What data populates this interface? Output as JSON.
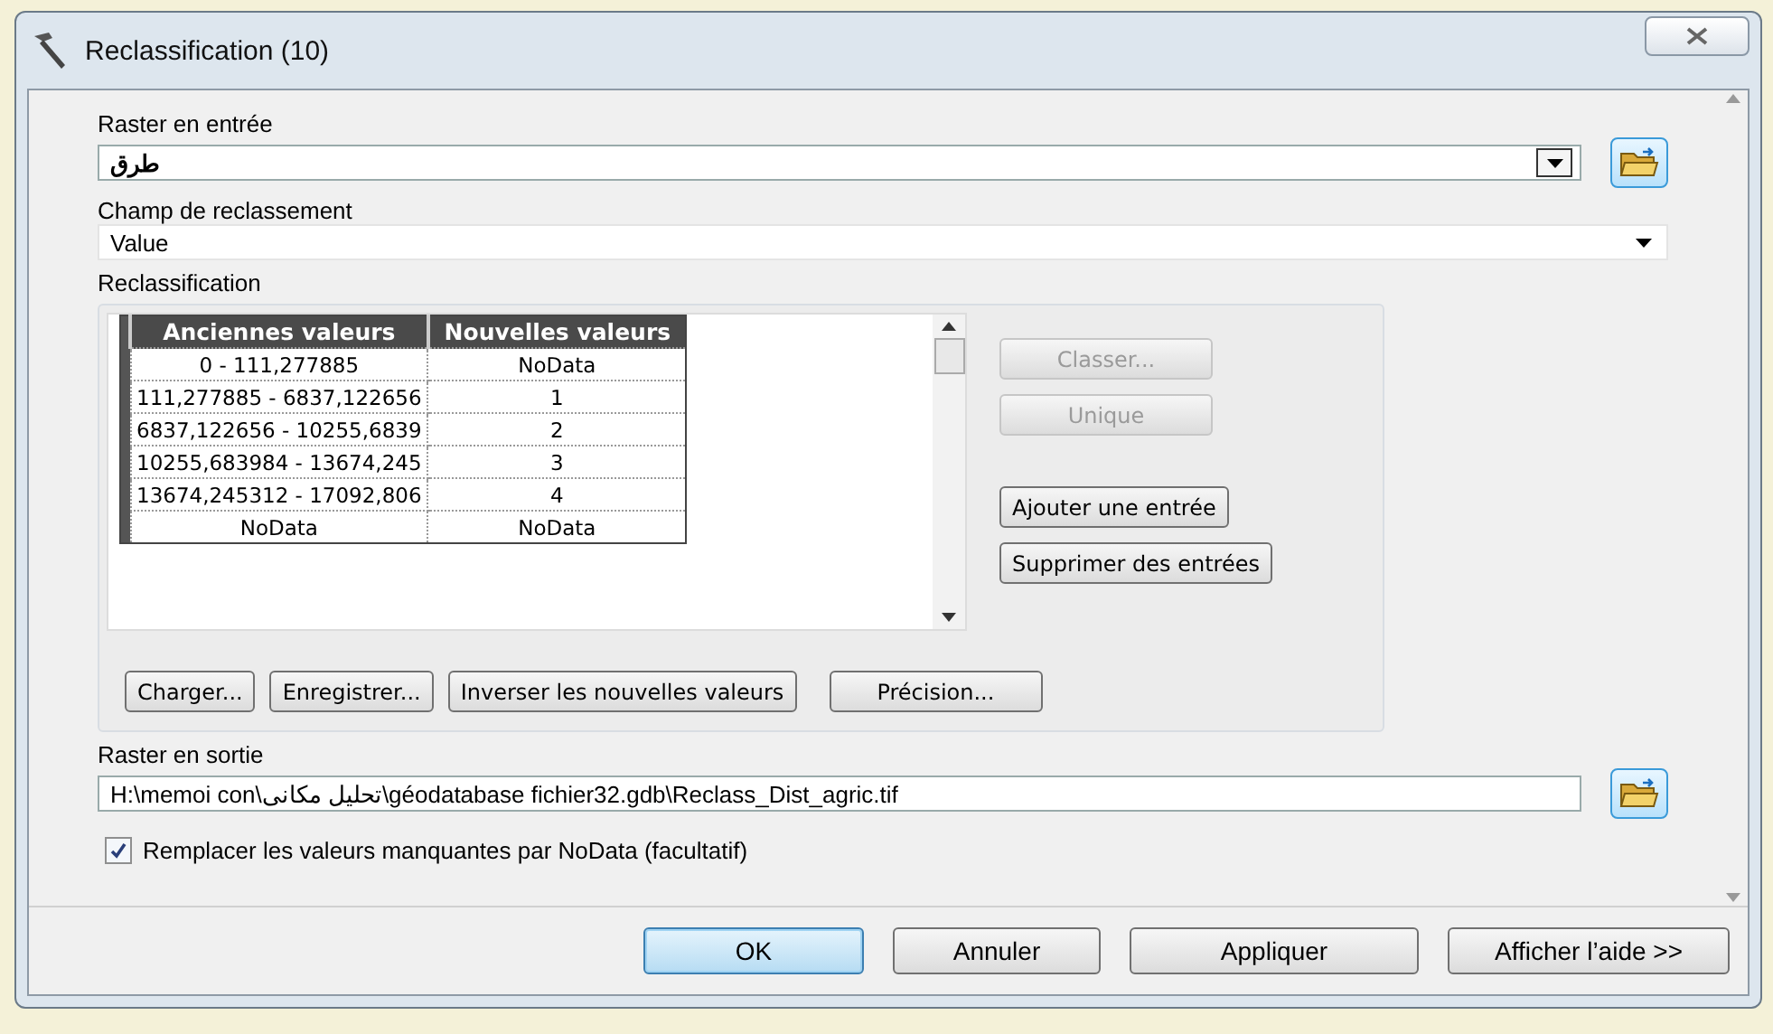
{
  "window": {
    "title": "Reclassification (10)"
  },
  "input_raster": {
    "label": "Raster en entrée",
    "value": "طرق"
  },
  "reclass_field": {
    "label": "Champ de reclassement",
    "value": "Value"
  },
  "reclassification": {
    "label": "Reclassification",
    "table": {
      "columns": [
        "Anciennes valeurs",
        "Nouvelles valeurs"
      ],
      "rows": [
        {
          "old": "0 - 111,277885",
          "new": "NoData"
        },
        {
          "old": "111,277885 - 6837,122656",
          "new": "1"
        },
        {
          "old": "6837,122656 - 10255,6839",
          "new": "2"
        },
        {
          "old": "10255,683984 - 13674,245",
          "new": "3"
        },
        {
          "old": "13674,245312 - 17092,806",
          "new": "4"
        },
        {
          "old": "NoData",
          "new": "NoData"
        }
      ]
    },
    "side_buttons": [
      {
        "label": "Classer...",
        "disabled": true
      },
      {
        "label": "Unique",
        "disabled": true
      },
      {
        "label": "Ajouter une entrée",
        "disabled": false
      },
      {
        "label": "Supprimer des entrées",
        "disabled": false
      }
    ],
    "bottom_buttons": [
      "Charger...",
      "Enregistrer...",
      "Inverser les nouvelles valeurs",
      "Précision..."
    ]
  },
  "output_raster": {
    "label": "Raster en sortie",
    "value": "H:\\memoi con\\تحليل مكانى\\géodatabase fichier32.gdb\\Reclass_Dist_agric.tif"
  },
  "nodata_option": {
    "label": "Remplacer les valeurs manquantes par NoData (facultatif)",
    "checked": true
  },
  "footer_buttons": [
    {
      "label": "OK",
      "default": true
    },
    {
      "label": "Annuler",
      "default": false
    },
    {
      "label": "Appliquer",
      "default": false
    },
    {
      "label": "Afficher l’aide >>",
      "default": false
    }
  ]
}
